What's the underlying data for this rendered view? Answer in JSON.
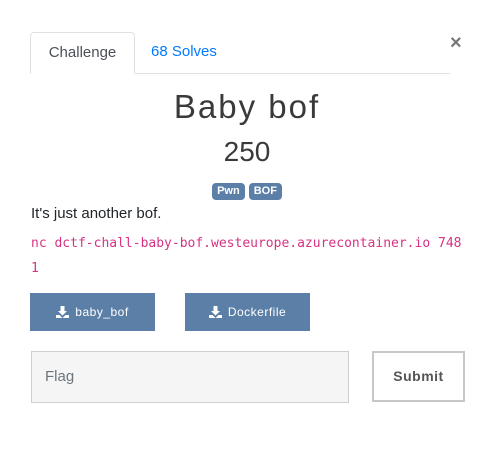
{
  "tabs": {
    "challenge": "Challenge",
    "solves": "68 Solves"
  },
  "close_glyph": "×",
  "challenge": {
    "name": "Baby bof",
    "points": "250",
    "tags": [
      "Pwn",
      "BOF"
    ],
    "description": "It's just another bof.",
    "connection": "nc dctf-chall-baby-bof.westeurope.azurecontainer.io 7481"
  },
  "files": [
    {
      "label": "baby_bof",
      "icon": "download-icon"
    },
    {
      "label": "Dockerfile",
      "icon": "download-icon"
    }
  ],
  "flag_form": {
    "placeholder": "Flag",
    "submit_label": "Submit"
  },
  "colors": {
    "tag_bg": "#5b7fa6",
    "button_bg": "#5b7fa6",
    "link": "#007bff",
    "code": "#d63384"
  }
}
